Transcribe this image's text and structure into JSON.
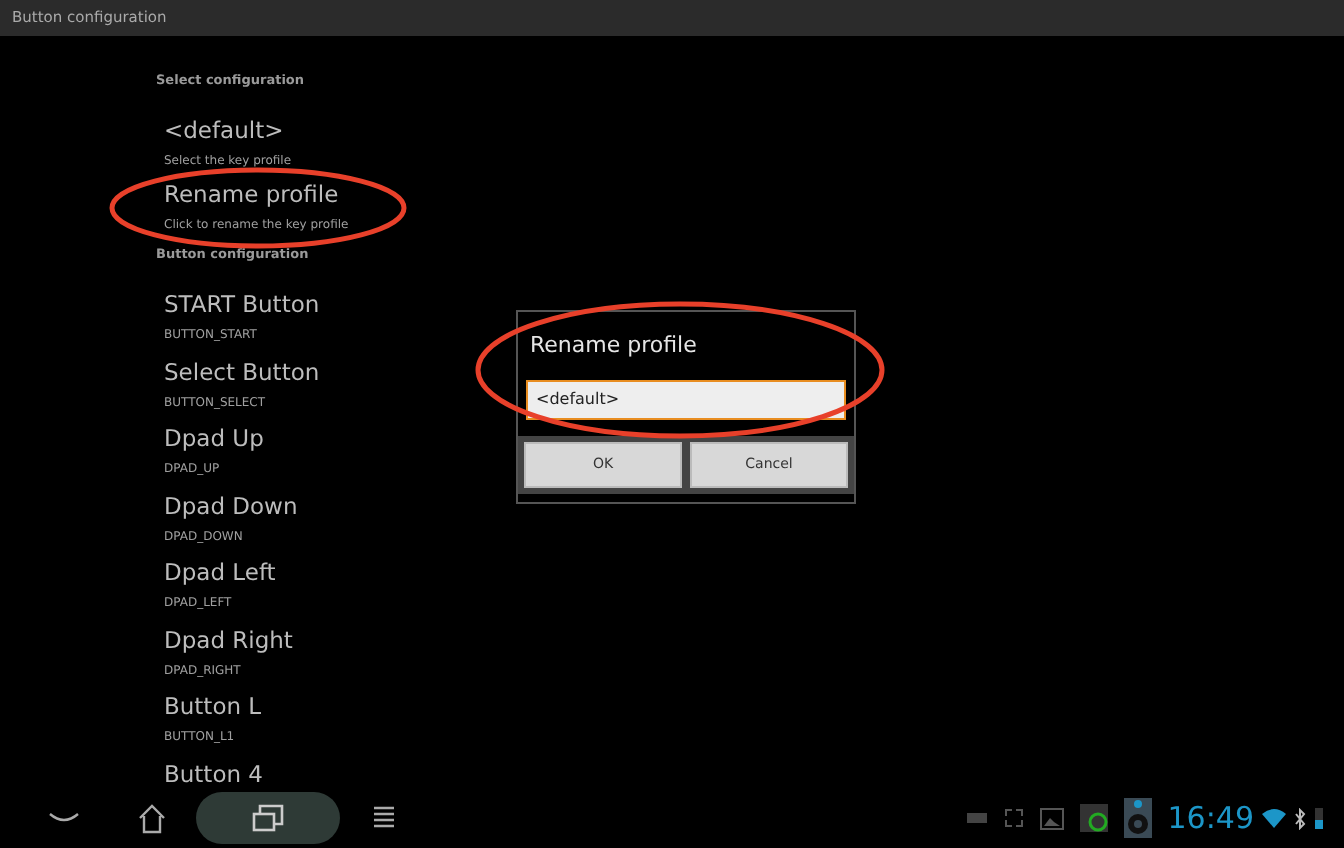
{
  "window": {
    "title": "Button configuration"
  },
  "sections": [
    {
      "header": "Select configuration",
      "items": [
        {
          "title": "<default>",
          "subtitle": "Select the key profile"
        },
        {
          "title": "Rename profile",
          "subtitle": "Click to rename the key profile"
        }
      ]
    },
    {
      "header": "Button configuration",
      "items": [
        {
          "title": "START Button",
          "subtitle": "BUTTON_START"
        },
        {
          "title": "Select Button",
          "subtitle": "BUTTON_SELECT"
        },
        {
          "title": "Dpad Up",
          "subtitle": "DPAD_UP"
        },
        {
          "title": "Dpad Down",
          "subtitle": "DPAD_DOWN"
        },
        {
          "title": "Dpad Left",
          "subtitle": "DPAD_LEFT"
        },
        {
          "title": "Dpad Right",
          "subtitle": "DPAD_RIGHT"
        },
        {
          "title": "Button L",
          "subtitle": "BUTTON_L1"
        },
        {
          "title": "Button 4"
        }
      ]
    }
  ],
  "dialog": {
    "title": "Rename profile",
    "value": "<default>",
    "buttons": [
      "OK",
      "Cancel"
    ]
  },
  "nav": [
    {
      "kind": "back",
      "selected": false
    },
    {
      "kind": "home",
      "selected": false
    },
    {
      "kind": "recent",
      "selected": true
    },
    {
      "kind": "menu",
      "selected": false
    }
  ],
  "status_bar": {
    "time": "16:49"
  }
}
